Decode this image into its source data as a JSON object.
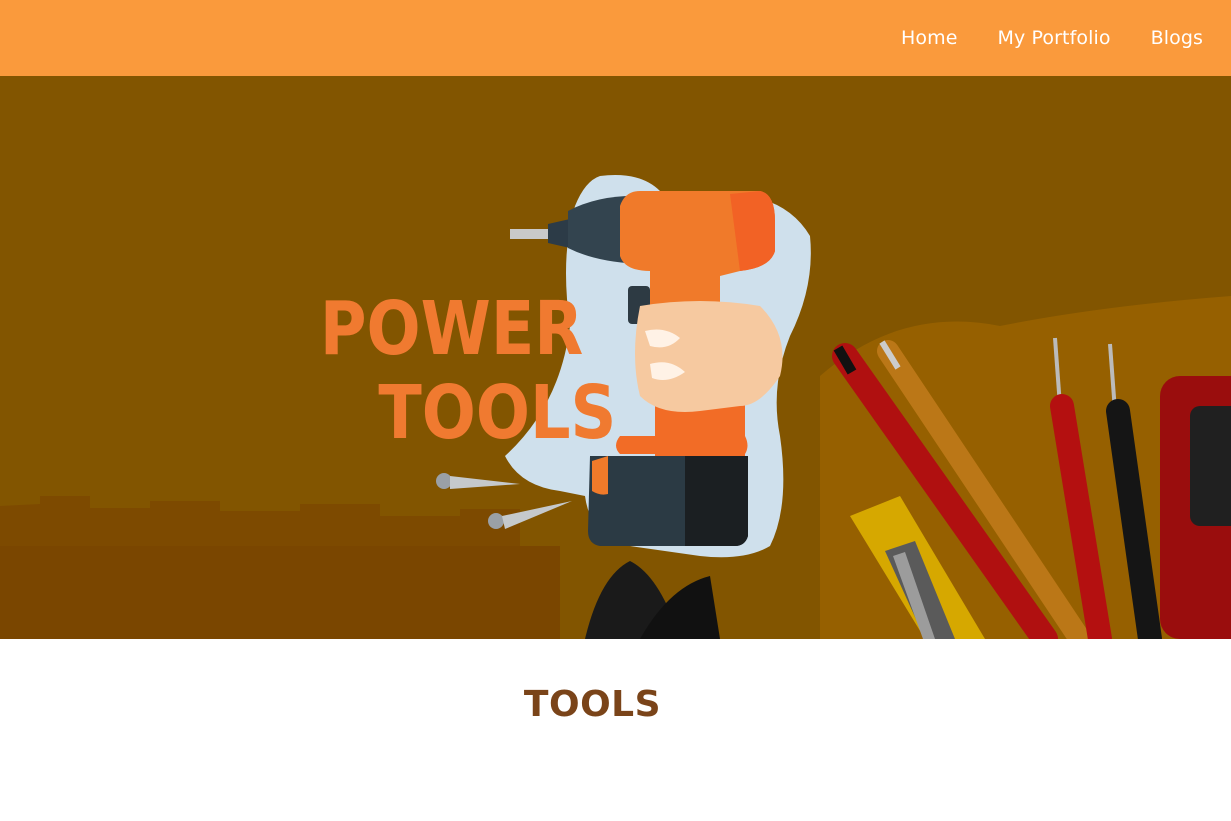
{
  "colors": {
    "nav_background": "#fa9a3c",
    "nav_text": "#ffffff",
    "hero_overlay": "#825500",
    "title_color": "#7a4419"
  },
  "nav": {
    "links": [
      {
        "label": "Home"
      },
      {
        "label": "My Portfolio"
      },
      {
        "label": "Blogs"
      }
    ]
  },
  "hero": {
    "logo_line1": "POWER",
    "logo_line2": "TOOLS",
    "icon": "power-drill-icon"
  },
  "main": {
    "title": "TOOLS"
  }
}
